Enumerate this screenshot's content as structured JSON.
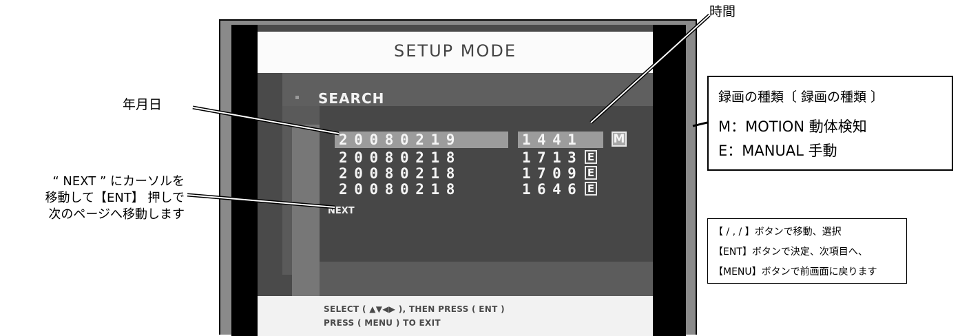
{
  "screen": {
    "title": "SETUP MODE",
    "section_label": "SEARCH",
    "records": [
      {
        "date": "20080219",
        "time": "1441",
        "type": "M",
        "selected": true
      },
      {
        "date": "20080218",
        "time": "1713",
        "type": "E",
        "selected": false
      },
      {
        "date": "20080218",
        "time": "1709",
        "type": "E",
        "selected": false
      },
      {
        "date": "20080218",
        "time": "1646",
        "type": "E",
        "selected": false
      }
    ],
    "next_label": "NEXT",
    "footer": {
      "line1": "SELECT ( ▲▼◀▶ ), THEN PRESS ( ENT )",
      "line2": "PRESS ( MENU ) TO EXIT"
    }
  },
  "annotations": {
    "time_label": "時間",
    "date_label": "年月日",
    "next_note": {
      "line1": "“ NEXT ” にカーソルを",
      "line2": "移動して【ENT】 押しで",
      "line3": "次のページへ移動します"
    },
    "record_types": {
      "title": "録画の種類〔 録画の種類 〕",
      "motion": "M：MOTION  動体検知",
      "manual": "E：MANUAL  手動"
    },
    "key_help": {
      "line1": "【  /  ,   /  】ボタンで移動、選択",
      "line2": "【ENT】ボタンで決定、次項目へ、",
      "line3": "【MENU】ボタンで前画面に戻ります"
    }
  },
  "colors": {
    "screen_bg": "#4a4a4a",
    "title_bg": "#fbfbfb",
    "selection": "#9c9c9c",
    "monitor_frame": "#8a8a8a"
  }
}
